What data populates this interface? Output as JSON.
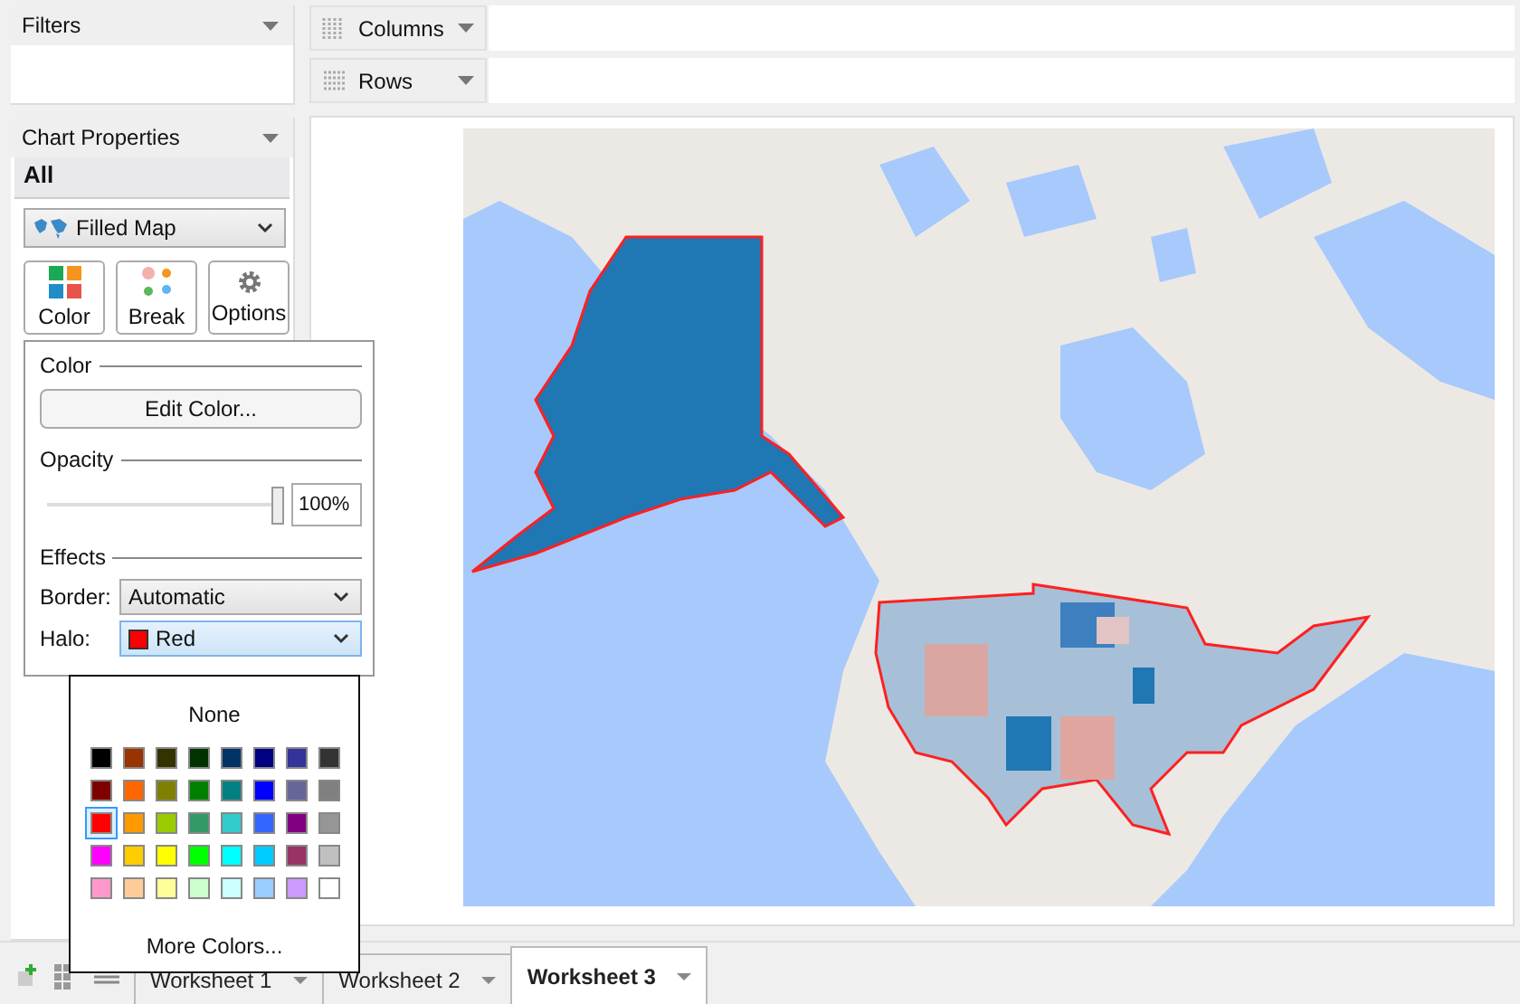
{
  "filters_panel": {
    "title": "Filters"
  },
  "shelves": [
    {
      "kind": "columns",
      "label": "Columns"
    },
    {
      "kind": "rows",
      "label": "Rows"
    }
  ],
  "chart_properties": {
    "title": "Chart Properties",
    "section": "All",
    "chart_type": "Filled Map",
    "buttons": [
      {
        "kind": "color",
        "label": "Color"
      },
      {
        "kind": "break",
        "label": "Break"
      },
      {
        "kind": "options",
        "label": "Options"
      }
    ]
  },
  "color_popup": {
    "color_heading": "Color",
    "edit_button": "Edit Color...",
    "opacity_heading": "Opacity",
    "opacity": {
      "level": 1,
      "reading": "100%"
    },
    "effects_heading": "Effects",
    "border": {
      "label": "Border:",
      "value": "Automatic"
    },
    "halo": {
      "label": "Halo:",
      "value": "Red",
      "color": "#ff0000"
    }
  },
  "palette": {
    "none_label": "None",
    "more_label": "More Colors...",
    "swatches": [
      {
        "color": "#000000",
        "selected": false
      },
      {
        "color": "#993300",
        "selected": false
      },
      {
        "color": "#333300",
        "selected": false
      },
      {
        "color": "#003300",
        "selected": false
      },
      {
        "color": "#003366",
        "selected": false
      },
      {
        "color": "#000080",
        "selected": false
      },
      {
        "color": "#333399",
        "selected": false
      },
      {
        "color": "#333333",
        "selected": false
      },
      {
        "color": "#800000",
        "selected": false
      },
      {
        "color": "#ff6600",
        "selected": false
      },
      {
        "color": "#808000",
        "selected": false
      },
      {
        "color": "#008000",
        "selected": false
      },
      {
        "color": "#008080",
        "selected": false
      },
      {
        "color": "#0000ff",
        "selected": false
      },
      {
        "color": "#666699",
        "selected": false
      },
      {
        "color": "#808080",
        "selected": false
      },
      {
        "color": "#ff0000",
        "selected": true
      },
      {
        "color": "#ff9900",
        "selected": false
      },
      {
        "color": "#99cc00",
        "selected": false
      },
      {
        "color": "#339966",
        "selected": false
      },
      {
        "color": "#33cccc",
        "selected": false
      },
      {
        "color": "#3366ff",
        "selected": false
      },
      {
        "color": "#800080",
        "selected": false
      },
      {
        "color": "#969696",
        "selected": false
      },
      {
        "color": "#ff00ff",
        "selected": false
      },
      {
        "color": "#ffcc00",
        "selected": false
      },
      {
        "color": "#ffff00",
        "selected": false
      },
      {
        "color": "#00ff00",
        "selected": false
      },
      {
        "color": "#00ffff",
        "selected": false
      },
      {
        "color": "#00ccff",
        "selected": false
      },
      {
        "color": "#993366",
        "selected": false
      },
      {
        "color": "#c0c0c0",
        "selected": false
      },
      {
        "color": "#ff99cc",
        "selected": false
      },
      {
        "color": "#ffcc99",
        "selected": false
      },
      {
        "color": "#ffff99",
        "selected": false
      },
      {
        "color": "#ccffcc",
        "selected": false
      },
      {
        "color": "#ccffff",
        "selected": false
      },
      {
        "color": "#99ccff",
        "selected": false
      },
      {
        "color": "#cc99ff",
        "selected": false
      },
      {
        "color": "#ffffff",
        "selected": false
      }
    ]
  },
  "sheet_tabs": [
    {
      "label": "Worksheet 1",
      "selected": false
    },
    {
      "label": "Worksheet 2",
      "selected": false
    },
    {
      "label": "Worksheet 3",
      "selected": true
    }
  ]
}
